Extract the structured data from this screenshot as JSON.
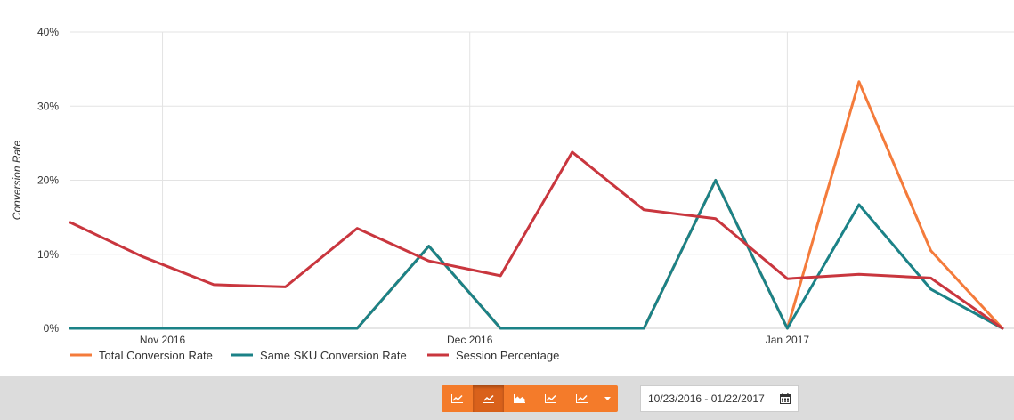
{
  "chart_data": {
    "type": "line",
    "ylabel": "Conversion Rate",
    "ylim": [
      0,
      40
    ],
    "yticks": [
      "0%",
      "10%",
      "20%",
      "30%",
      "40%"
    ],
    "xticks": [
      {
        "label": "Nov 2016",
        "date": "2016-11-01"
      },
      {
        "label": "Dec 2016",
        "date": "2016-12-01"
      },
      {
        "label": "Jan 2017",
        "date": "2017-01-01"
      }
    ],
    "x": [
      "2016-10-23",
      "2016-10-30",
      "2016-11-06",
      "2016-11-13",
      "2016-11-20",
      "2016-11-27",
      "2016-12-04",
      "2016-12-11",
      "2016-12-18",
      "2016-12-25",
      "2017-01-01",
      "2017-01-08",
      "2017-01-15",
      "2017-01-22"
    ],
    "series": [
      {
        "name": "Total Conversion Rate",
        "color": "#f47b3b",
        "values": [
          0,
          0,
          0,
          0,
          0,
          11.1,
          0,
          0,
          0,
          20.0,
          0,
          33.3,
          10.5,
          0
        ]
      },
      {
        "name": "Same SKU Conversion Rate",
        "color": "#1b8287",
        "values": [
          0,
          0,
          0,
          0,
          0,
          11.1,
          0,
          0,
          0,
          20.0,
          0,
          16.7,
          5.3,
          0
        ]
      },
      {
        "name": "Session Percentage",
        "color": "#c9363e",
        "values": [
          14.3,
          9.7,
          5.9,
          5.6,
          13.5,
          9.1,
          7.1,
          23.8,
          16.0,
          14.8,
          6.7,
          7.3,
          6.8,
          0
        ]
      }
    ],
    "grid": true,
    "legend_position": "bottom-left"
  },
  "toolbar": {
    "chart_type_buttons": [
      {
        "icon": "line-chart-icon",
        "active": false
      },
      {
        "icon": "line-chart-icon",
        "active": true
      },
      {
        "icon": "area-chart-icon",
        "active": false
      },
      {
        "icon": "line-chart-icon",
        "active": false
      },
      {
        "icon": "line-chart-icon",
        "active": false
      }
    ],
    "dropdown_icon": "caret-down-icon",
    "date_range": "10/23/2016 - 01/22/2017",
    "calendar_icon": "calendar-icon",
    "accent_color": "#f47b2a"
  }
}
